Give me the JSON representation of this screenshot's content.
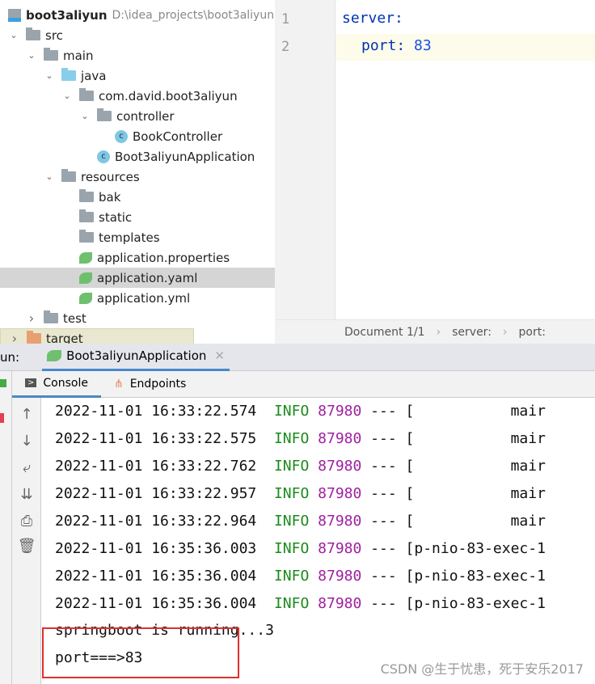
{
  "project": {
    "name": "boot3aliyun",
    "path": "D:\\idea_projects\\boot3aliyun",
    "items": [
      {
        "label": "src",
        "level": 1,
        "icon": "folder",
        "open": true
      },
      {
        "label": "main",
        "level": 2,
        "icon": "folder",
        "open": true
      },
      {
        "label": "java",
        "level": 3,
        "icon": "source-folder",
        "open": true
      },
      {
        "label": "com.david.boot3aliyun",
        "level": 4,
        "icon": "package",
        "open": true
      },
      {
        "label": "controller",
        "level": 5,
        "icon": "package",
        "open": true
      },
      {
        "label": "BookController",
        "level": 6,
        "icon": "class"
      },
      {
        "label": "Boot3aliyunApplication",
        "level": 5,
        "icon": "spring-class"
      },
      {
        "label": "resources",
        "level": 3,
        "icon": "resources-folder",
        "open": true
      },
      {
        "label": "bak",
        "level": 4,
        "icon": "folder"
      },
      {
        "label": "static",
        "level": 4,
        "icon": "folder"
      },
      {
        "label": "templates",
        "level": 4,
        "icon": "folder"
      },
      {
        "label": "application.properties",
        "level": 4,
        "icon": "spring-config"
      },
      {
        "label": "application.yaml",
        "level": 4,
        "icon": "spring-config",
        "selected": true
      },
      {
        "label": "application.yml",
        "level": 4,
        "icon": "spring-config"
      },
      {
        "label": "test",
        "level": 2,
        "icon": "folder",
        "open": false
      },
      {
        "label": "target",
        "level": 1,
        "icon": "excluded-folder",
        "open": false
      }
    ]
  },
  "editor": {
    "lines": [
      {
        "num": "1",
        "key": "server:",
        "val": ""
      },
      {
        "num": "2",
        "key": "port:",
        "val": "83"
      }
    ],
    "breadcrumbs": [
      "Document 1/1",
      "server:",
      "port:"
    ]
  },
  "run": {
    "label": "un:",
    "tab": "Boot3aliyunApplication",
    "console_tabs": [
      "Console",
      "Endpoints"
    ],
    "logs": [
      {
        "ts": "2022-11-01 16:33:22.574",
        "level": "INFO",
        "pid": "87980",
        "rest": "--- [           mair"
      },
      {
        "ts": "2022-11-01 16:33:22.575",
        "level": "INFO",
        "pid": "87980",
        "rest": "--- [           mair"
      },
      {
        "ts": "2022-11-01 16:33:22.762",
        "level": "INFO",
        "pid": "87980",
        "rest": "--- [           mair"
      },
      {
        "ts": "2022-11-01 16:33:22.957",
        "level": "INFO",
        "pid": "87980",
        "rest": "--- [           mair"
      },
      {
        "ts": "2022-11-01 16:33:22.964",
        "level": "INFO",
        "pid": "87980",
        "rest": "--- [           mair"
      },
      {
        "ts": "2022-11-01 16:35:36.003",
        "level": "INFO",
        "pid": "87980",
        "rest": "--- [p-nio-83-exec-1"
      },
      {
        "ts": "2022-11-01 16:35:36.004",
        "level": "INFO",
        "pid": "87980",
        "rest": "--- [p-nio-83-exec-1"
      },
      {
        "ts": "2022-11-01 16:35:36.004",
        "level": "INFO",
        "pid": "87980",
        "rest": "--- [p-nio-83-exec-1"
      }
    ],
    "plain": [
      "springboot is running...3",
      "port===>83"
    ]
  },
  "watermark": "CSDN @生于忧患，死于安乐2017"
}
